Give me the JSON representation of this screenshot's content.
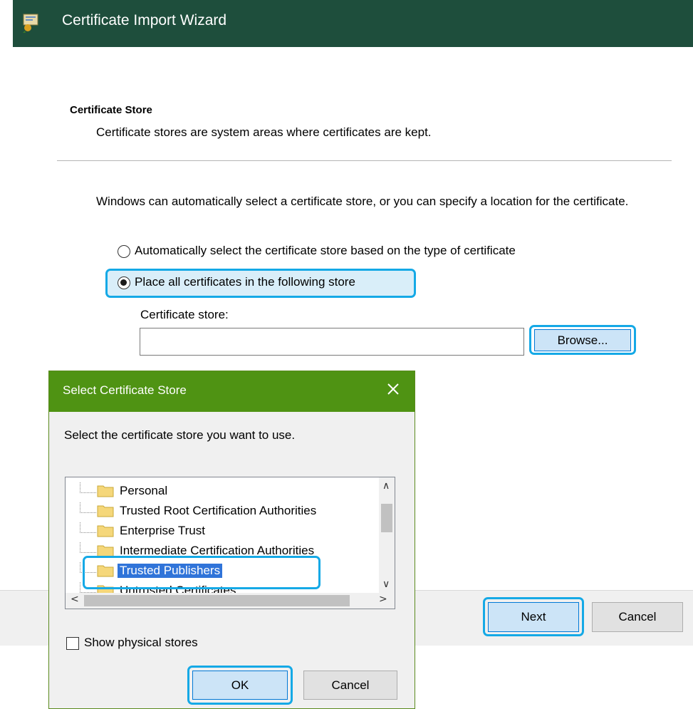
{
  "wizard": {
    "title": "Certificate Import Wizard",
    "section_title": "Certificate Store",
    "section_desc": "Certificate stores are system areas where certificates are kept.",
    "intro": "Windows can automatically select a certificate store, or you can specify a location for the certificate.",
    "radio_auto_label": "Automatically select the certificate store based on the type of certificate",
    "radio_place_label": "Place all certificates in the following store",
    "store_label": "Certificate store:",
    "store_value": "",
    "browse_label": "Browse...",
    "next_label": "Next",
    "cancel_label": "Cancel"
  },
  "dialog": {
    "title": "Select Certificate Store",
    "prompt": "Select the certificate store you want to use.",
    "items": [
      "Personal",
      "Trusted Root Certification Authorities",
      "Enterprise Trust",
      "Intermediate Certification Authorities",
      "Trusted Publishers",
      "Untrusted Certificates"
    ],
    "selected_item": "Trusted Publishers",
    "show_physical_label": "Show physical stores",
    "ok_label": "OK",
    "cancel_label": "Cancel"
  },
  "colors": {
    "wizard_titlebar": "#1e4e3c",
    "dialog_titlebar": "#4f9313",
    "highlight": "#15a9e6",
    "selection": "#3074d9"
  }
}
